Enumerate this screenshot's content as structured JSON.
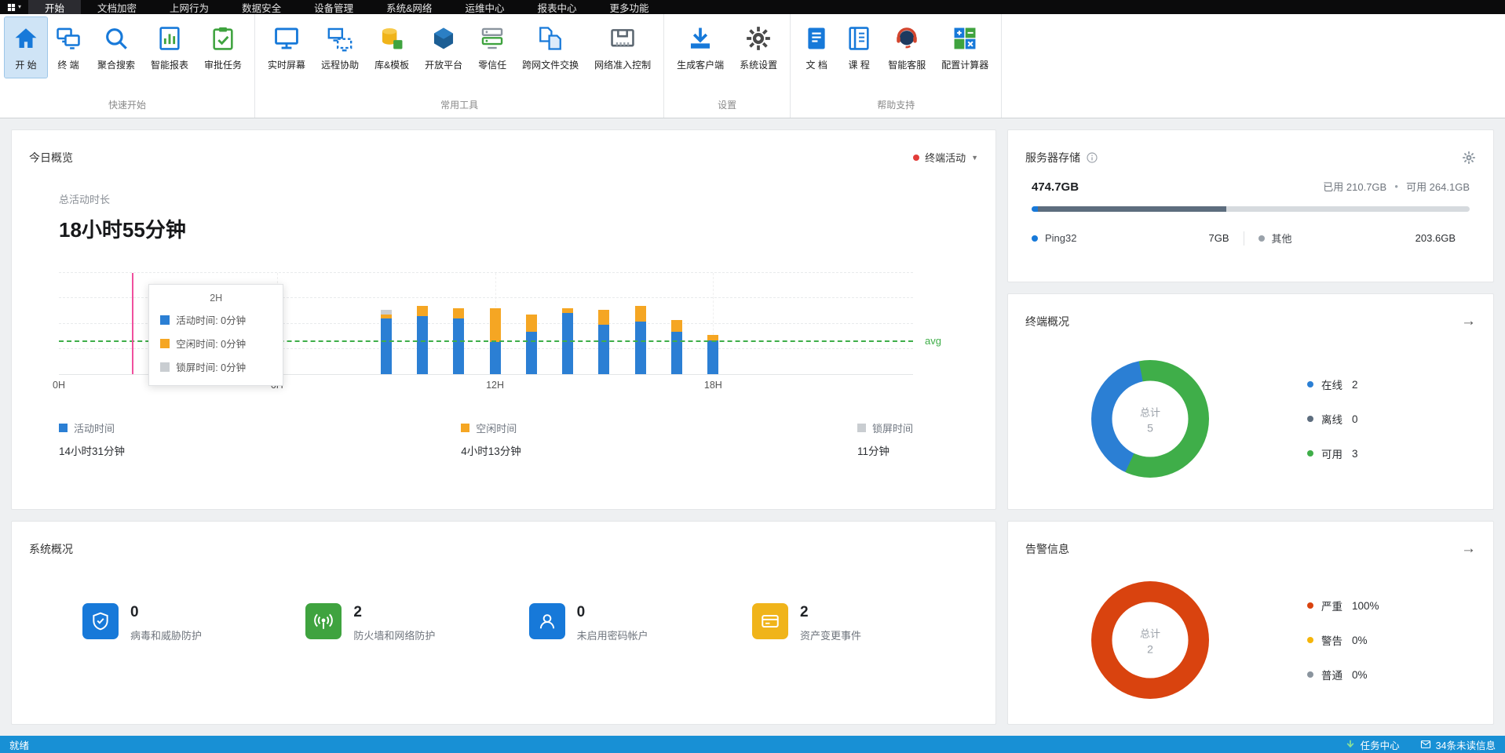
{
  "menubar": {
    "active": "开始",
    "items": [
      "开始",
      "文档加密",
      "上网行为",
      "数据安全",
      "设备管理",
      "系统&网络",
      "运维中心",
      "报表中心",
      "更多功能"
    ]
  },
  "ribbon": {
    "groups": [
      {
        "label": "快速开始",
        "buttons": [
          {
            "label": "开 始",
            "icon": "home",
            "active": true
          },
          {
            "label": "终 端",
            "icon": "terminal"
          },
          {
            "label": "聚合搜索",
            "icon": "search"
          },
          {
            "label": "智能报表",
            "icon": "report"
          },
          {
            "label": "审批任务",
            "icon": "approval"
          }
        ]
      },
      {
        "label": "常用工具",
        "buttons": [
          {
            "label": "实时屏幕",
            "icon": "screen"
          },
          {
            "label": "远程协助",
            "icon": "remote"
          },
          {
            "label": "库&模板",
            "icon": "library"
          },
          {
            "label": "开放平台",
            "icon": "platform"
          },
          {
            "label": "零信任",
            "icon": "zerotrust"
          },
          {
            "label": "跨网文件交换",
            "icon": "exchange"
          },
          {
            "label": "网络准入控制",
            "icon": "network"
          }
        ]
      },
      {
        "label": "设置",
        "buttons": [
          {
            "label": "生成客户端",
            "icon": "client"
          },
          {
            "label": "系统设置",
            "icon": "settings"
          }
        ]
      },
      {
        "label": "帮助支持",
        "buttons": [
          {
            "label": "文 档",
            "icon": "docs"
          },
          {
            "label": "课 程",
            "icon": "course"
          },
          {
            "label": "智能客服",
            "icon": "service"
          },
          {
            "label": "配置计算器",
            "icon": "calculator"
          }
        ]
      }
    ]
  },
  "today": {
    "title": "今日概览",
    "filter_label": "终端活动",
    "filter_dot_color": "#e23c39",
    "total_label": "总活动时长",
    "total_value": "18小时55分钟",
    "avg_label": "avg",
    "tooltip": {
      "title": "2H",
      "rows": [
        {
          "label": "活动时间: 0分钟",
          "color": "#2b7fd4"
        },
        {
          "label": "空闲时间: 0分钟",
          "color": "#f5a623"
        },
        {
          "label": "锁屏时间: 0分钟",
          "color": "#c9cdd1"
        }
      ]
    },
    "legend": [
      {
        "label": "活动时间",
        "value": "14小时31分钟",
        "color": "#2b7fd4"
      },
      {
        "label": "空闲时间",
        "value": "4小时13分钟",
        "color": "#f5a623"
      },
      {
        "label": "锁屏时间",
        "value": "11分钟",
        "color": "#c9cdd1"
      }
    ]
  },
  "chart_data": {
    "type": "stacked_bar",
    "title": "今日概览 - 终端活动",
    "x_unit": "hour",
    "x_range": [
      0,
      23.5
    ],
    "x_ticks": [
      "0H",
      "6H",
      "12H",
      "18H"
    ],
    "y_max_minutes": 60,
    "hours": [
      9,
      10,
      11,
      12,
      13,
      14,
      15,
      16,
      17,
      18
    ],
    "series": [
      {
        "name": "活动时间",
        "color": "#2b7fd4",
        "values": [
          33,
          34,
          33,
          19,
          25,
          36,
          29,
          31,
          25,
          20
        ]
      },
      {
        "name": "空闲时间",
        "color": "#f5a623",
        "values": [
          2,
          6,
          6,
          20,
          10,
          3,
          9,
          9,
          7,
          3
        ]
      },
      {
        "name": "锁屏时间",
        "color": "#c9cdd1",
        "values": [
          3,
          0,
          0,
          0,
          0,
          0,
          0,
          0,
          0,
          0
        ]
      }
    ],
    "avg_minutes": 19,
    "cursor_hour": 2,
    "grid": true,
    "legend_position": "bottom"
  },
  "storage": {
    "title": "服务器存储",
    "total": "474.7GB",
    "used_label": "已用 210.7GB",
    "free_label": "可用 264.1GB",
    "segments": [
      {
        "name": "Ping32",
        "pct": 1.5,
        "color": "#1779d9"
      },
      {
        "name": "其他",
        "pct": 42.9,
        "color": "#5d6d7e"
      }
    ],
    "legend": [
      {
        "label": "Ping32",
        "value": "7GB",
        "color": "#1779d9"
      },
      {
        "label": "其他",
        "value": "203.6GB",
        "color": "#9aa2aa"
      }
    ]
  },
  "terminal_overview": {
    "title": "终端概况",
    "center_label": "总计",
    "center_value": "5",
    "segments": [
      {
        "label": "在线",
        "pct": 40,
        "color": "#2b7fd4"
      },
      {
        "label": "可用",
        "pct": 60,
        "color": "#3fae49"
      }
    ],
    "legend": [
      {
        "label": "在线",
        "value": "2",
        "color": "#2b7fd4"
      },
      {
        "label": "离线",
        "value": "0",
        "color": "#5d6d7e"
      },
      {
        "label": "可用",
        "value": "3",
        "color": "#3fae49"
      }
    ]
  },
  "system_overview": {
    "title": "系统概况",
    "items": [
      {
        "icon": "shield",
        "color": "#1779d9",
        "value": "0",
        "label": "病毒和威胁防护"
      },
      {
        "icon": "firewall",
        "color": "#3fa33f",
        "value": "2",
        "label": "防火墙和网络防护"
      },
      {
        "icon": "user",
        "color": "#1779d9",
        "value": "0",
        "label": "未启用密码帐户"
      },
      {
        "icon": "asset",
        "color": "#f0b41a",
        "value": "2",
        "label": "资产变更事件"
      }
    ]
  },
  "alarm": {
    "title": "告警信息",
    "center_label": "总计",
    "center_value": "2",
    "segments": [
      {
        "label": "严重",
        "pct": 100,
        "color": "#d9430f"
      }
    ],
    "legend": [
      {
        "label": "严重",
        "value": "100%",
        "color": "#d9430f"
      },
      {
        "label": "警告",
        "value": "0%",
        "color": "#f5b50a"
      },
      {
        "label": "普通",
        "value": "0%",
        "color": "#8a949e"
      }
    ]
  },
  "statusbar": {
    "ready": "就绪",
    "task_center": "任务中心",
    "messages": "34条未读信息"
  }
}
